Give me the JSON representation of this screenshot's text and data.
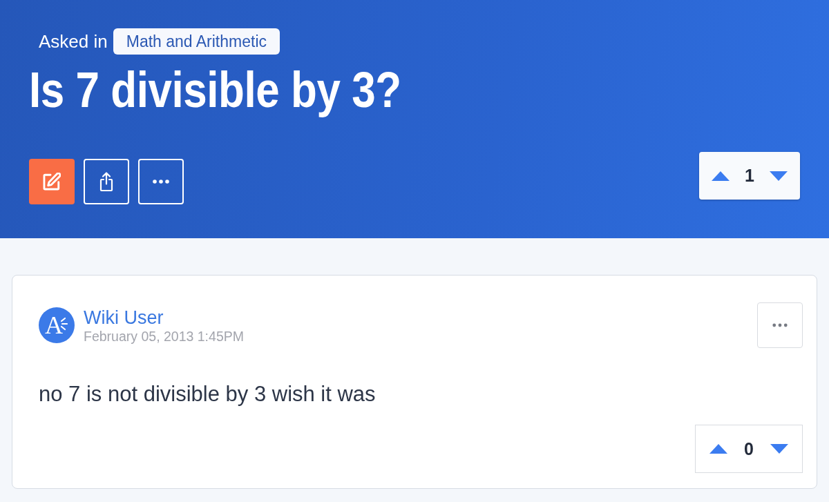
{
  "question": {
    "asked_in_label": "Asked in",
    "category": "Math and Arithmetic",
    "title": "Is 7 divisible by 3?",
    "actions": [
      {
        "kind": "edit"
      },
      {
        "kind": "share"
      },
      {
        "kind": "more"
      }
    ],
    "votes": "1"
  },
  "answers": [
    {
      "author": "Wiki User",
      "avatar_letter": "A",
      "date": "February 05, 2013 1:45PM",
      "text": "no 7 is not divisible by 3 wish it was",
      "votes": "0"
    }
  ]
}
